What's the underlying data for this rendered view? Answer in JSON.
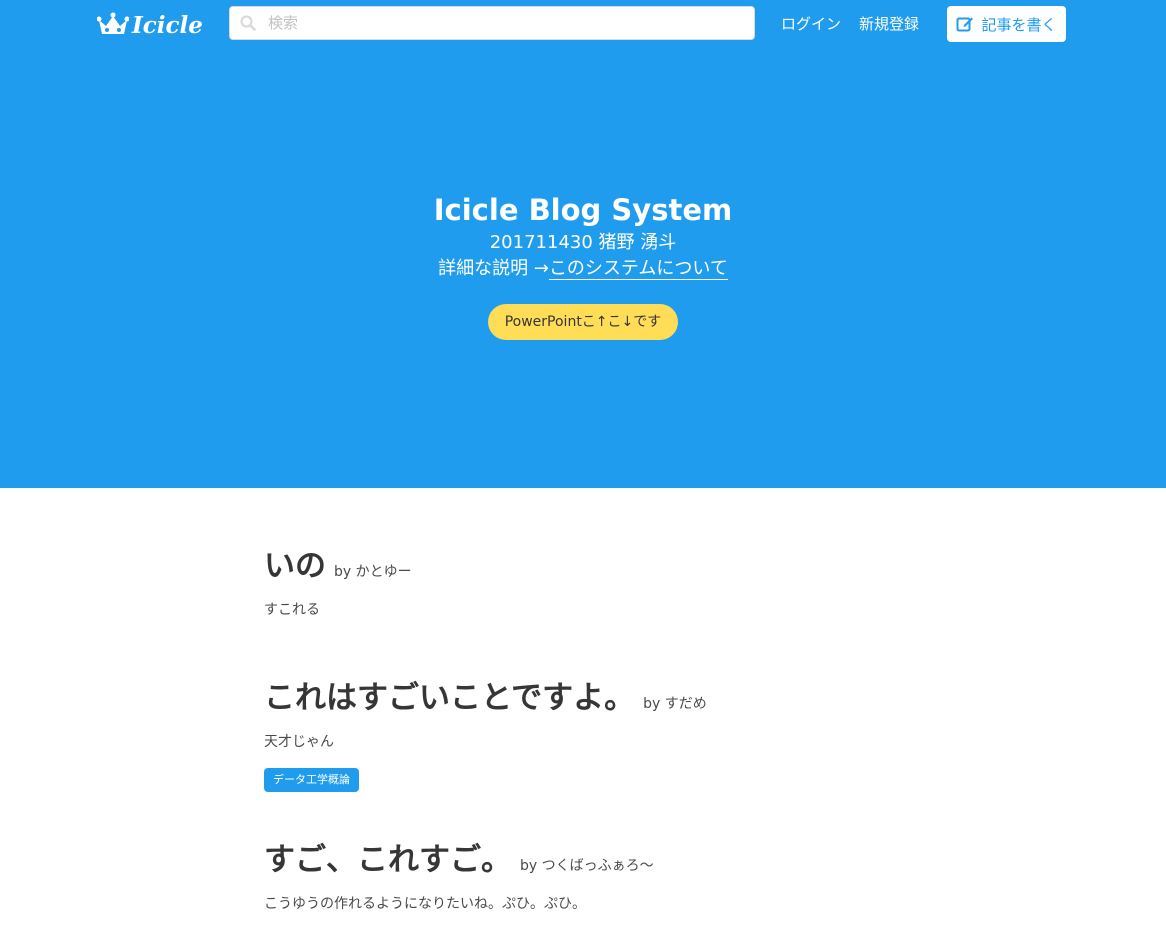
{
  "navbar": {
    "logo_text": "Icicle",
    "search_placeholder": "検索",
    "login": "ログイン",
    "signup": "新規登録",
    "write": "記事を書く"
  },
  "hero": {
    "title": "Icicle Blog System",
    "subtitle": "201711430 猪野 湧斗",
    "detail_prefix": "詳細な説明 →",
    "detail_link": "このシステムについて",
    "ppt_button": "PowerPointこ↑こ↓です"
  },
  "posts": [
    {
      "title": "いの",
      "by": "by かとゆー",
      "body": "すこれる",
      "tags": []
    },
    {
      "title": "これはすごいことですよ。",
      "by": "by すだめ",
      "body": "天才じゃん",
      "tags": [
        "データ工学概論"
      ]
    },
    {
      "title": "すご、これすご。",
      "by": "by つくばっふぁろ〜",
      "body": "こうゆうの作れるようになりたいね。ぷひ。ぷひ。",
      "tags": []
    }
  ],
  "colors": {
    "primary": "#209cee",
    "warning": "#ffdd57",
    "text": "#363636"
  },
  "icons": {
    "logo": "crown-icon",
    "search": "search-icon",
    "write": "edit-icon"
  }
}
